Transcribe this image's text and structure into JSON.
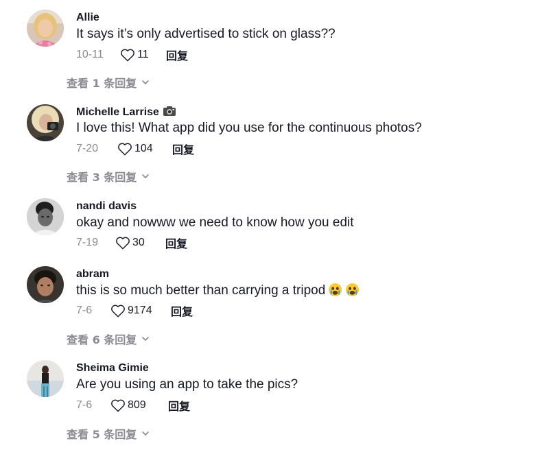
{
  "comments": [
    {
      "username": "Allie",
      "text": "It says it’s only advertised to stick on glass??",
      "date": "10-11",
      "likes": "11",
      "reply_label": "回复",
      "view_replies": "查看 1 条回复"
    },
    {
      "username": "Michelle Larrise",
      "username_icon": "camera-icon",
      "text": "I love this! What app did you use for the continuous photos?",
      "date": "7-20",
      "likes": "104",
      "reply_label": "回复",
      "view_replies": "查看 3 条回复"
    },
    {
      "username": "nandi davis",
      "text": "okay and nowww we need to know how you edit",
      "date": "7-19",
      "likes": "30",
      "reply_label": "回复"
    },
    {
      "username": "abram",
      "text": "this is so much better than carrying a tripod",
      "text_emojis": [
        "crying-face-emoji",
        "crying-face-emoji"
      ],
      "date": "7-6",
      "likes": "9174",
      "reply_label": "回复",
      "view_replies": "查看 6 条回复"
    },
    {
      "username": "Sheima Gimie",
      "text": "Are you using an app to take the pics?",
      "date": "7-6",
      "likes": "809",
      "reply_label": "回复",
      "view_replies": "查看 5 条回复"
    }
  ],
  "colors": {
    "primary_text": "#161823",
    "secondary_text": "#8a8b91",
    "background": "#ffffff"
  }
}
